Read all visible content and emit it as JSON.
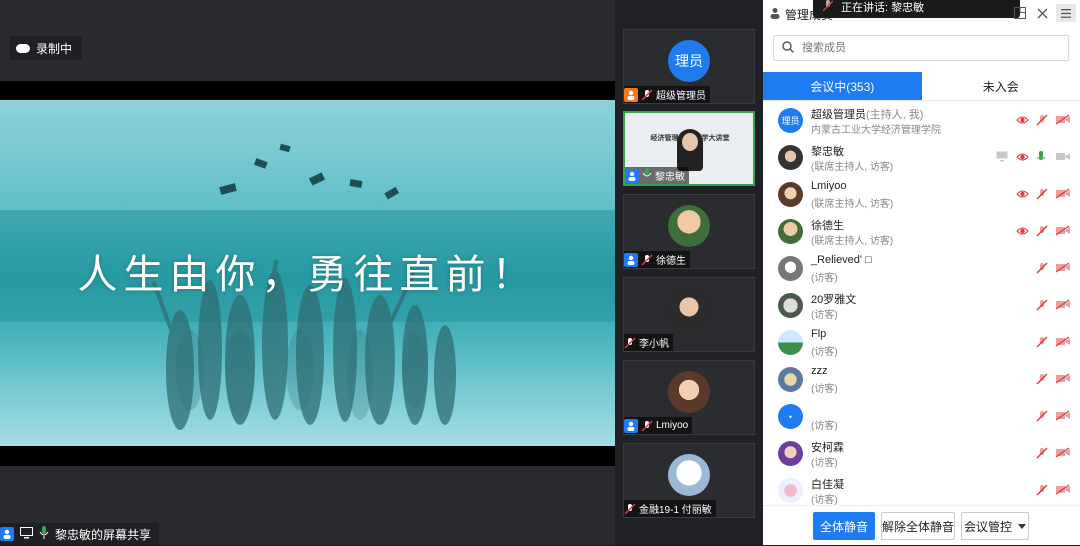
{
  "share": {
    "recording_label": "录制中",
    "slide_text": "人生由你，勇往直前！",
    "footer_label": "黎忠敏的屏幕共享"
  },
  "speaking": {
    "label": "正在讲话: 黎忠敏"
  },
  "videos": [
    {
      "name": "超级管理员",
      "avatar_text": "理员"
    },
    {
      "name": "黎忠敏",
      "slide_title": "经济管理学院 博学大讲堂"
    },
    {
      "name": "徐德生"
    },
    {
      "name": "李小帆"
    },
    {
      "name": "Lmiyoo"
    },
    {
      "name": "金融19-1 付丽敏"
    }
  ],
  "panel": {
    "title": "管理成员",
    "search_placeholder": "搜索成员",
    "tab_in_meeting": "会议中(353)",
    "tab_not_joined": "未入会",
    "members": [
      {
        "name": "超级管理员",
        "role": "(主持人, 我)",
        "sub": "内蒙古工业大学经济管理学院",
        "avatar_text": "理员"
      },
      {
        "name": "黎忠敏",
        "role": "",
        "sub": "(联席主持人, 访客)"
      },
      {
        "name": "Lmiyoo",
        "role": "",
        "sub": "(联席主持人, 访客)"
      },
      {
        "name": "徐德生",
        "role": "",
        "sub": "(联席主持人, 访客)"
      },
      {
        "name": "_Relieved' □",
        "role": "",
        "sub": "(访客)"
      },
      {
        "name": "20罗雅文",
        "role": "",
        "sub": "(访客)"
      },
      {
        "name": "Flp",
        "role": "",
        "sub": "(访客)"
      },
      {
        "name": "zzz",
        "role": "",
        "sub": "(访客)"
      },
      {
        "name": "",
        "role": "",
        "sub": "(访客)"
      },
      {
        "name": "安柯霖",
        "role": "",
        "sub": "(访客)"
      },
      {
        "name": "白佳凝",
        "role": "",
        "sub": "(访客)"
      }
    ],
    "btn_mute_all": "全体静音",
    "btn_unmute_all": "解除全体静音",
    "btn_meeting_control": "会议管控"
  },
  "colors": {
    "accent": "#1f7cf0",
    "teal_slide": "#2aa0a8",
    "red_muted": "#e0393e",
    "green_active": "#3aa34a"
  }
}
